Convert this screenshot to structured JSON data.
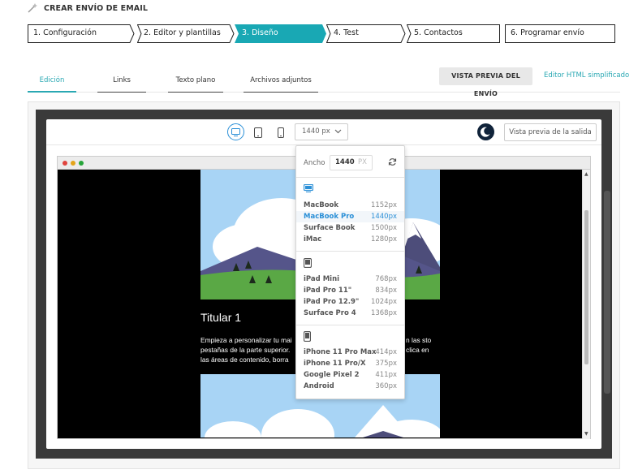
{
  "header": {
    "title": "CREAR ENVÍO DE EMAIL",
    "icon": "magic-wand-icon"
  },
  "steps": [
    {
      "label": "1. Configuración"
    },
    {
      "label": "2. Editor y plantillas"
    },
    {
      "label": "3. Diseño",
      "active": true
    },
    {
      "label": "4. Test"
    },
    {
      "label": "5. Contactos"
    },
    {
      "label": "6. Programar envío"
    }
  ],
  "tabs": [
    {
      "label": "Edición",
      "active": true
    },
    {
      "label": "Links"
    },
    {
      "label": "Texto plano"
    },
    {
      "label": "Archivos adjuntos"
    }
  ],
  "actions": {
    "preview_send": "VISTA PREVIA DEL ENVÍO",
    "html_editor": "Editor HTML simplificado"
  },
  "toolbar": {
    "width_value": "1440 px",
    "output_preview": "Vista previa de la salida",
    "devices": [
      "desktop-icon",
      "tablet-icon",
      "mobile-icon"
    ]
  },
  "dropdown": {
    "width_label": "Ancho",
    "width_value": "1440",
    "width_unit": "PX",
    "groups": [
      {
        "icon": "desktop-icon",
        "items": [
          {
            "name": "MacBook",
            "size": "1152px"
          },
          {
            "name": "MacBook Pro",
            "size": "1440px",
            "selected": true
          },
          {
            "name": "Surface Book",
            "size": "1500px"
          },
          {
            "name": "iMac",
            "size": "1280px"
          }
        ]
      },
      {
        "icon": "tablet-icon",
        "items": [
          {
            "name": "iPad Mini",
            "size": "768px"
          },
          {
            "name": "iPad Pro 11\"",
            "size": "834px"
          },
          {
            "name": "iPad Pro 12.9\"",
            "size": "1024px"
          },
          {
            "name": "Surface Pro 4",
            "size": "1368px"
          }
        ]
      },
      {
        "icon": "mobile-icon",
        "items": [
          {
            "name": "iPhone 11 Pro Max",
            "size": "414px"
          },
          {
            "name": "iPhone 11 Pro/X",
            "size": "375px"
          },
          {
            "name": "Google Pixel 2",
            "size": "411px"
          },
          {
            "name": "Android",
            "size": "360px"
          }
        ]
      }
    ]
  },
  "preview": {
    "heading": "Titular 1",
    "body_left": "Empieza a personalizar tu mai pestañas de la parte superior. las áreas de contenido, borra",
    "body_right": "n las sto clica en"
  },
  "colors": {
    "accent": "#2aa8b3",
    "selected": "#2a8fd7",
    "sky": "#a8d4f5",
    "grass": "#5aa845",
    "mountain": "#4d4d7a"
  }
}
